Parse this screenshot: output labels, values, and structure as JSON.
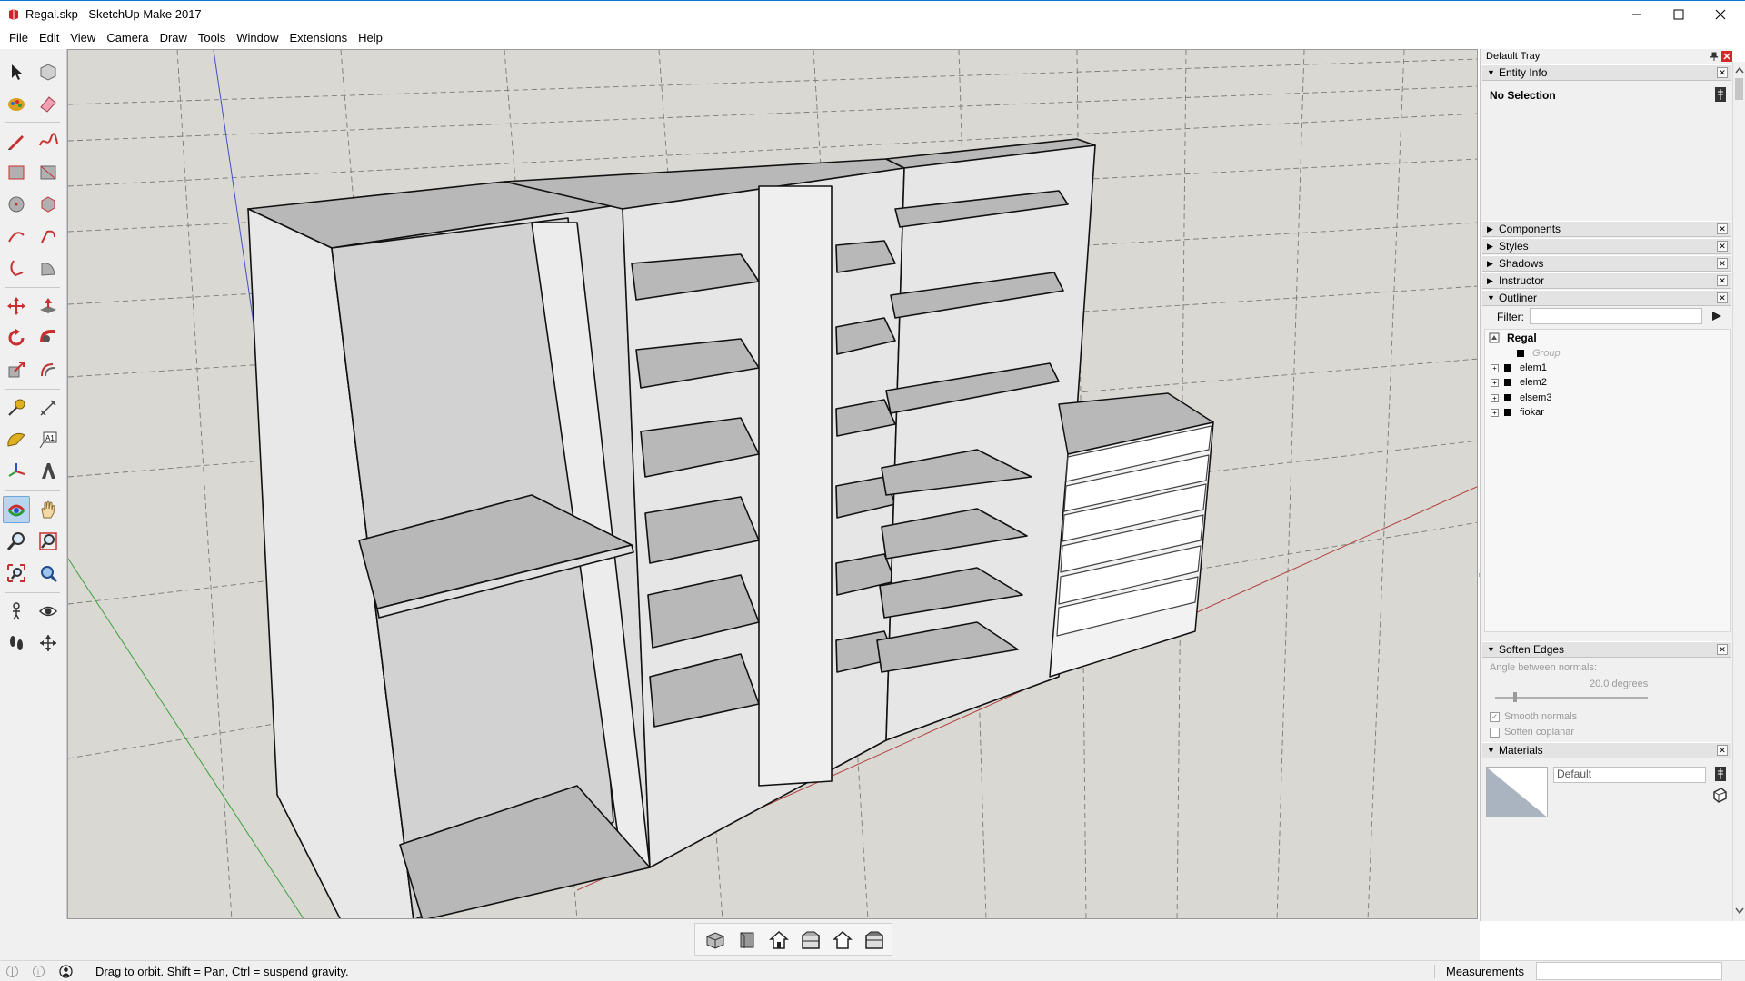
{
  "window": {
    "title": "Regal.skp - SketchUp Make 2017",
    "minimize_icon": "minimize-icon",
    "maximize_icon": "maximize-icon",
    "close_icon": "close-icon"
  },
  "menu": {
    "items": [
      "File",
      "Edit",
      "View",
      "Camera",
      "Draw",
      "Tools",
      "Window",
      "Extensions",
      "Help"
    ]
  },
  "toolbar": {
    "tools": [
      "select",
      "make-component",
      "paint-bucket",
      "eraser",
      "line",
      "freehand",
      "rectangle",
      "rotated-rectangle",
      "circle",
      "polygon",
      "arc",
      "two-point-arc",
      "three-point-arc",
      "pie",
      "move",
      "push-pull",
      "rotate",
      "follow-me",
      "scale",
      "offset",
      "tape-measure",
      "dimension",
      "protractor",
      "text",
      "axes",
      "3d-text",
      "orbit",
      "pan",
      "zoom",
      "zoom-window",
      "zoom-extents",
      "previous-view",
      "position-camera",
      "look-around",
      "walk",
      "section-plane"
    ],
    "active_tool": "orbit"
  },
  "view_tools": [
    "iso",
    "top",
    "front",
    "right",
    "back",
    "left"
  ],
  "status": {
    "hint": "Drag to orbit. Shift = Pan, Ctrl = suspend gravity.",
    "measurements_label": "Measurements",
    "measurements_value": ""
  },
  "tray": {
    "title": "Default Tray",
    "entity_info": {
      "label": "Entity Info",
      "selection": "No Selection"
    },
    "collapsed_panels": [
      "Components",
      "Styles",
      "Shadows",
      "Instructor"
    ],
    "outliner": {
      "label": "Outliner",
      "filter_label": "Filter:",
      "filter_value": "",
      "root": "Regal",
      "items": [
        {
          "label": "Group",
          "expandable": false,
          "dimmed": true
        },
        {
          "label": "elem1",
          "expandable": true,
          "dimmed": false
        },
        {
          "label": "elem2",
          "expandable": true,
          "dimmed": false
        },
        {
          "label": "elsem3",
          "expandable": true,
          "dimmed": false
        },
        {
          "label": "fiokar",
          "expandable": true,
          "dimmed": false
        }
      ]
    },
    "soften_edges": {
      "label": "Soften Edges",
      "angle_label": "Angle between normals:",
      "angle_value": "20.0  degrees",
      "smooth_normals_label": "Smooth normals",
      "smooth_normals_checked": true,
      "soften_coplanar_label": "Soften coplanar",
      "soften_coplanar_checked": false
    },
    "materials": {
      "label": "Materials",
      "name": "Default"
    }
  },
  "colors": {
    "viewport_bg": "#d9d8d3",
    "shelf_side": "#e9e9e9",
    "shelf_top": "#b4b4b4",
    "red_axis": "#b04040",
    "green_axis": "#3ca03c",
    "blue_axis": "#4050c8",
    "title_accent": "#0078d7"
  }
}
